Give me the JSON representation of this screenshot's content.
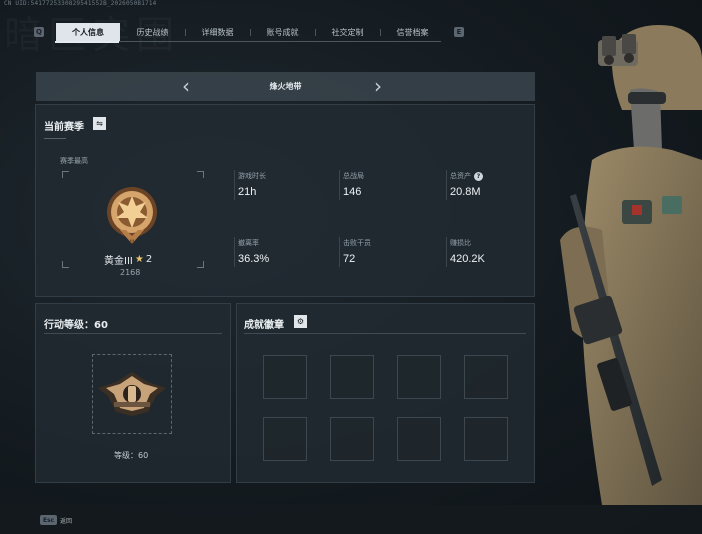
{
  "uid_text": "CN UID:5417725330829541552B_2026050B1714",
  "watermark_text": "暗区突围",
  "tabs": {
    "left_key": "Q",
    "right_key": "E",
    "items": [
      {
        "label": "个人信息",
        "active": true
      },
      {
        "label": "历史战绩",
        "active": false
      },
      {
        "label": "详细数据",
        "active": false
      },
      {
        "label": "账号成就",
        "active": false
      },
      {
        "label": "社交定制",
        "active": false
      },
      {
        "label": "信誉档案",
        "active": false
      }
    ]
  },
  "map": {
    "name": "烽火地带",
    "prev_icon": "chevron-left-icon",
    "next_icon": "chevron-right-icon"
  },
  "season": {
    "title": "当前赛季",
    "switch_icon": "swap-icon",
    "subtitle": "赛季最高",
    "rank_name": "黄金III",
    "rank_stars": "2",
    "rank_score": "2168",
    "badge_colors": {
      "rim": "#b57e48",
      "core": "#d6a56c",
      "dark": "#6b4426"
    }
  },
  "stats": [
    {
      "label": "游戏时长",
      "value": "21h"
    },
    {
      "label": "总战局",
      "value": "146"
    },
    {
      "label": "总资产",
      "value": "20.8M",
      "help": "?"
    },
    {
      "label": "撤离率",
      "value": "36.3%"
    },
    {
      "label": "击败干员",
      "value": "72"
    },
    {
      "label": "赚损比",
      "value": "420.2K"
    }
  ],
  "action_level": {
    "title": "行动等级：",
    "value": "60",
    "level_label": "等级：",
    "level_value": "60"
  },
  "achievements": {
    "title": "成就徽章",
    "settings_icon": "gear-icon",
    "slot_count": 8
  },
  "footer": {
    "esc_key": "Esc",
    "back_label": "返回"
  },
  "colors": {
    "accent": "#dfe5ea",
    "panel": "#222b32",
    "star": "#e5c36a"
  }
}
